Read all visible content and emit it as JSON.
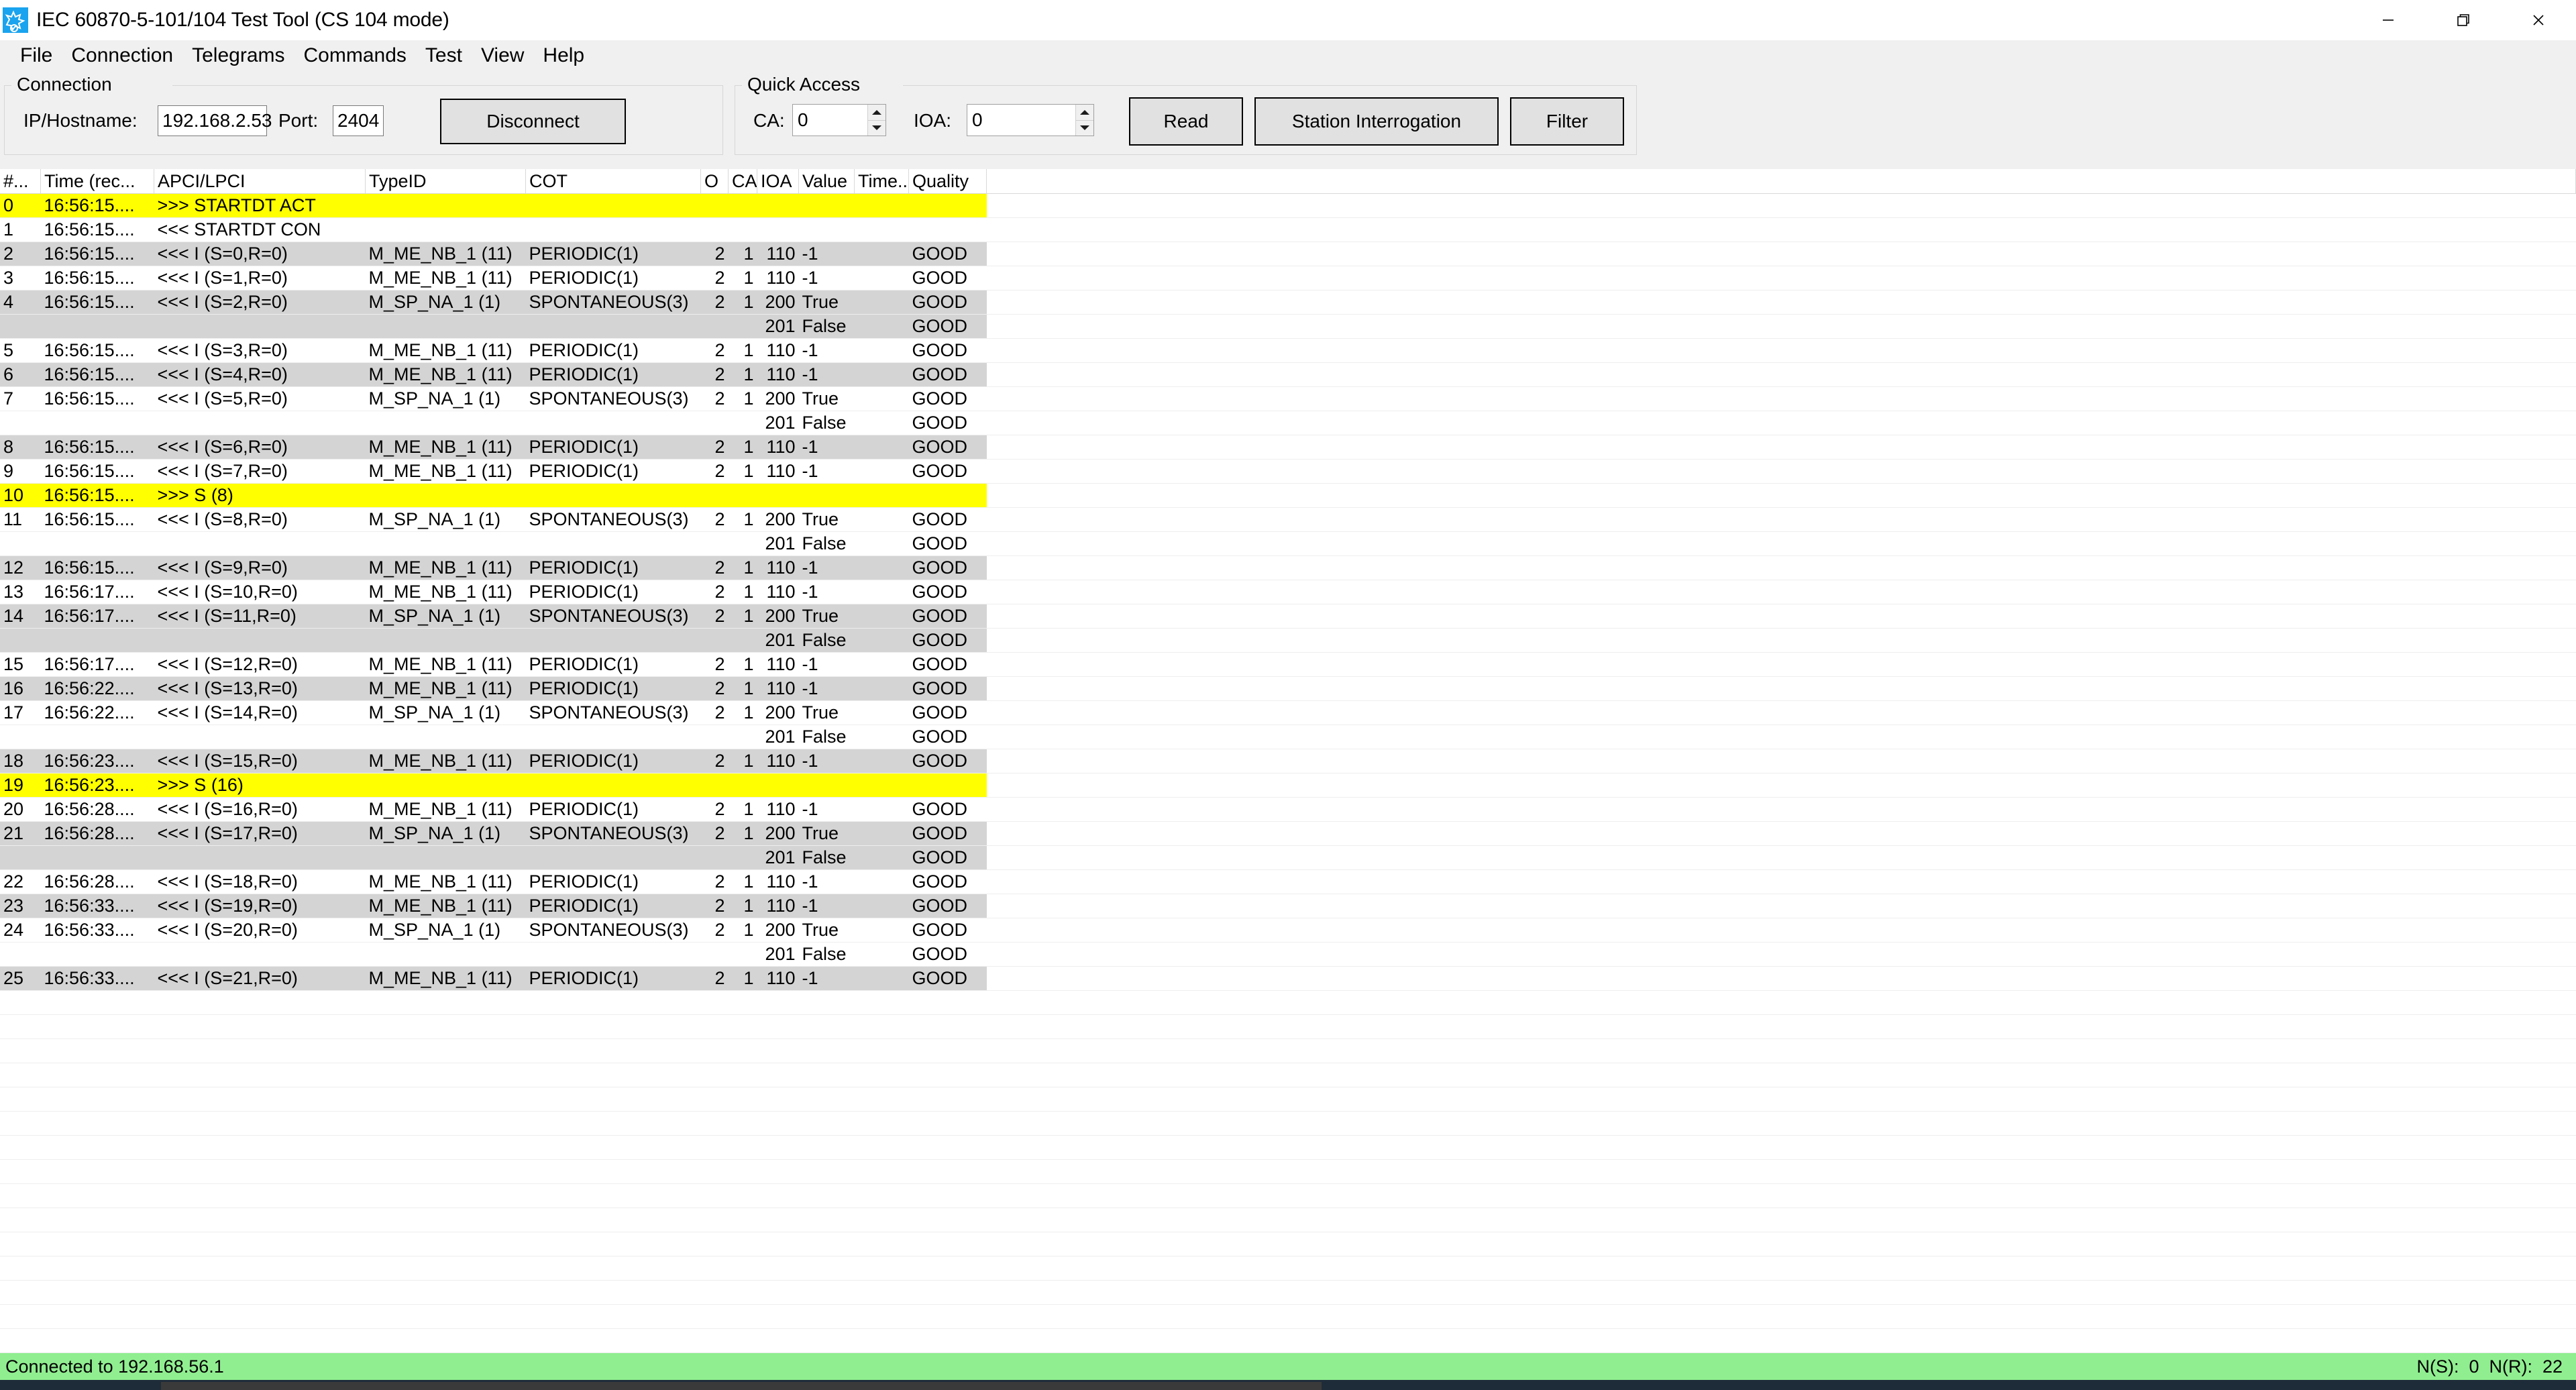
{
  "window": {
    "title": "IEC 60870-5-101/104 Test Tool (CS 104 mode)",
    "icon": "gear-app-icon",
    "minimize_label": "Minimize",
    "maximize_label": "Restore",
    "close_label": "Close"
  },
  "menu": {
    "items": [
      {
        "label": "File"
      },
      {
        "label": "Connection"
      },
      {
        "label": "Telegrams"
      },
      {
        "label": "Commands"
      },
      {
        "label": "Test"
      },
      {
        "label": "View"
      },
      {
        "label": "Help"
      }
    ]
  },
  "connection": {
    "group_title": "Connection",
    "ip_label": "IP/Hostname:",
    "ip_value": "192.168.2.53",
    "port_label": "Port:",
    "port_value": "2404",
    "disconnect_label": "Disconnect"
  },
  "quick_access": {
    "group_title": "Quick Access",
    "ca_label": "CA:",
    "ca_value": "0",
    "ioa_label": "IOA:",
    "ioa_value": "0",
    "read_label": "Read",
    "station_interrogation_label": "Station Interrogation",
    "filter_label": "Filter"
  },
  "grid": {
    "columns": [
      "#...",
      "Time (rec...",
      "APCI/LPCI",
      "TypeID",
      "COT",
      "O",
      "CA",
      "IOA",
      "Value",
      "Time...",
      "Quality"
    ],
    "rows": [
      {
        "style": "yellow",
        "num": "0",
        "time": "16:56:15....",
        "apci": ">>> STARTDT ACT",
        "type": "",
        "cot": "",
        "o": "",
        "ca": "",
        "ioa": "",
        "value": "",
        "tm": "",
        "quality": ""
      },
      {
        "style": "plain",
        "num": "1",
        "time": "16:56:15....",
        "apci": "<<< STARTDT CON",
        "type": "",
        "cot": "",
        "o": "",
        "ca": "",
        "ioa": "",
        "value": "",
        "tm": "",
        "quality": ""
      },
      {
        "style": "alt",
        "num": "2",
        "time": "16:56:15....",
        "apci": "<<< I (S=0,R=0)",
        "type": "M_ME_NB_1 (11)",
        "cot": "PERIODIC(1)",
        "o": "2",
        "ca": "1",
        "ioa": "110",
        "value": "-1",
        "tm": "",
        "quality": "GOOD"
      },
      {
        "style": "plain",
        "num": "3",
        "time": "16:56:15....",
        "apci": "<<< I (S=1,R=0)",
        "type": "M_ME_NB_1 (11)",
        "cot": "PERIODIC(1)",
        "o": "2",
        "ca": "1",
        "ioa": "110",
        "value": "-1",
        "tm": "",
        "quality": "GOOD"
      },
      {
        "style": "alt",
        "num": "4",
        "time": "16:56:15....",
        "apci": "<<< I (S=2,R=0)",
        "type": "M_SP_NA_1 (1)",
        "cot": "SPONTANEOUS(3)",
        "o": "2",
        "ca": "1",
        "ioa": "200",
        "value": "True",
        "tm": "",
        "quality": "GOOD"
      },
      {
        "style": "alt",
        "num": "",
        "time": "",
        "apci": "",
        "type": "",
        "cot": "",
        "o": "",
        "ca": "",
        "ioa": "201",
        "value": "False",
        "tm": "",
        "quality": "GOOD"
      },
      {
        "style": "plain",
        "num": "5",
        "time": "16:56:15....",
        "apci": "<<< I (S=3,R=0)",
        "type": "M_ME_NB_1 (11)",
        "cot": "PERIODIC(1)",
        "o": "2",
        "ca": "1",
        "ioa": "110",
        "value": "-1",
        "tm": "",
        "quality": "GOOD"
      },
      {
        "style": "alt",
        "num": "6",
        "time": "16:56:15....",
        "apci": "<<< I (S=4,R=0)",
        "type": "M_ME_NB_1 (11)",
        "cot": "PERIODIC(1)",
        "o": "2",
        "ca": "1",
        "ioa": "110",
        "value": "-1",
        "tm": "",
        "quality": "GOOD"
      },
      {
        "style": "plain",
        "num": "7",
        "time": "16:56:15....",
        "apci": "<<< I (S=5,R=0)",
        "type": "M_SP_NA_1 (1)",
        "cot": "SPONTANEOUS(3)",
        "o": "2",
        "ca": "1",
        "ioa": "200",
        "value": "True",
        "tm": "",
        "quality": "GOOD"
      },
      {
        "style": "plain",
        "num": "",
        "time": "",
        "apci": "",
        "type": "",
        "cot": "",
        "o": "",
        "ca": "",
        "ioa": "201",
        "value": "False",
        "tm": "",
        "quality": "GOOD"
      },
      {
        "style": "alt",
        "num": "8",
        "time": "16:56:15....",
        "apci": "<<< I (S=6,R=0)",
        "type": "M_ME_NB_1 (11)",
        "cot": "PERIODIC(1)",
        "o": "2",
        "ca": "1",
        "ioa": "110",
        "value": "-1",
        "tm": "",
        "quality": "GOOD"
      },
      {
        "style": "plain",
        "num": "9",
        "time": "16:56:15....",
        "apci": "<<< I (S=7,R=0)",
        "type": "M_ME_NB_1 (11)",
        "cot": "PERIODIC(1)",
        "o": "2",
        "ca": "1",
        "ioa": "110",
        "value": "-1",
        "tm": "",
        "quality": "GOOD"
      },
      {
        "style": "yellow",
        "num": "10",
        "time": "16:56:15....",
        "apci": ">>> S (8)",
        "type": "",
        "cot": "",
        "o": "",
        "ca": "",
        "ioa": "",
        "value": "",
        "tm": "",
        "quality": ""
      },
      {
        "style": "plain",
        "num": "11",
        "time": "16:56:15....",
        "apci": "<<< I (S=8,R=0)",
        "type": "M_SP_NA_1 (1)",
        "cot": "SPONTANEOUS(3)",
        "o": "2",
        "ca": "1",
        "ioa": "200",
        "value": "True",
        "tm": "",
        "quality": "GOOD"
      },
      {
        "style": "plain",
        "num": "",
        "time": "",
        "apci": "",
        "type": "",
        "cot": "",
        "o": "",
        "ca": "",
        "ioa": "201",
        "value": "False",
        "tm": "",
        "quality": "GOOD"
      },
      {
        "style": "alt",
        "num": "12",
        "time": "16:56:15....",
        "apci": "<<< I (S=9,R=0)",
        "type": "M_ME_NB_1 (11)",
        "cot": "PERIODIC(1)",
        "o": "2",
        "ca": "1",
        "ioa": "110",
        "value": "-1",
        "tm": "",
        "quality": "GOOD"
      },
      {
        "style": "plain",
        "num": "13",
        "time": "16:56:17....",
        "apci": "<<< I (S=10,R=0)",
        "type": "M_ME_NB_1 (11)",
        "cot": "PERIODIC(1)",
        "o": "2",
        "ca": "1",
        "ioa": "110",
        "value": "-1",
        "tm": "",
        "quality": "GOOD"
      },
      {
        "style": "alt",
        "num": "14",
        "time": "16:56:17....",
        "apci": "<<< I (S=11,R=0)",
        "type": "M_SP_NA_1 (1)",
        "cot": "SPONTANEOUS(3)",
        "o": "2",
        "ca": "1",
        "ioa": "200",
        "value": "True",
        "tm": "",
        "quality": "GOOD"
      },
      {
        "style": "alt",
        "num": "",
        "time": "",
        "apci": "",
        "type": "",
        "cot": "",
        "o": "",
        "ca": "",
        "ioa": "201",
        "value": "False",
        "tm": "",
        "quality": "GOOD"
      },
      {
        "style": "plain",
        "num": "15",
        "time": "16:56:17....",
        "apci": "<<< I (S=12,R=0)",
        "type": "M_ME_NB_1 (11)",
        "cot": "PERIODIC(1)",
        "o": "2",
        "ca": "1",
        "ioa": "110",
        "value": "-1",
        "tm": "",
        "quality": "GOOD"
      },
      {
        "style": "alt",
        "num": "16",
        "time": "16:56:22....",
        "apci": "<<< I (S=13,R=0)",
        "type": "M_ME_NB_1 (11)",
        "cot": "PERIODIC(1)",
        "o": "2",
        "ca": "1",
        "ioa": "110",
        "value": "-1",
        "tm": "",
        "quality": "GOOD"
      },
      {
        "style": "plain",
        "num": "17",
        "time": "16:56:22....",
        "apci": "<<< I (S=14,R=0)",
        "type": "M_SP_NA_1 (1)",
        "cot": "SPONTANEOUS(3)",
        "o": "2",
        "ca": "1",
        "ioa": "200",
        "value": "True",
        "tm": "",
        "quality": "GOOD"
      },
      {
        "style": "plain",
        "num": "",
        "time": "",
        "apci": "",
        "type": "",
        "cot": "",
        "o": "",
        "ca": "",
        "ioa": "201",
        "value": "False",
        "tm": "",
        "quality": "GOOD"
      },
      {
        "style": "alt",
        "num": "18",
        "time": "16:56:23....",
        "apci": "<<< I (S=15,R=0)",
        "type": "M_ME_NB_1 (11)",
        "cot": "PERIODIC(1)",
        "o": "2",
        "ca": "1",
        "ioa": "110",
        "value": "-1",
        "tm": "",
        "quality": "GOOD"
      },
      {
        "style": "yellow",
        "num": "19",
        "time": "16:56:23....",
        "apci": ">>> S (16)",
        "type": "",
        "cot": "",
        "o": "",
        "ca": "",
        "ioa": "",
        "value": "",
        "tm": "",
        "quality": ""
      },
      {
        "style": "plain",
        "num": "20",
        "time": "16:56:28....",
        "apci": "<<< I (S=16,R=0)",
        "type": "M_ME_NB_1 (11)",
        "cot": "PERIODIC(1)",
        "o": "2",
        "ca": "1",
        "ioa": "110",
        "value": "-1",
        "tm": "",
        "quality": "GOOD"
      },
      {
        "style": "alt",
        "num": "21",
        "time": "16:56:28....",
        "apci": "<<< I (S=17,R=0)",
        "type": "M_SP_NA_1 (1)",
        "cot": "SPONTANEOUS(3)",
        "o": "2",
        "ca": "1",
        "ioa": "200",
        "value": "True",
        "tm": "",
        "quality": "GOOD"
      },
      {
        "style": "alt",
        "num": "",
        "time": "",
        "apci": "",
        "type": "",
        "cot": "",
        "o": "",
        "ca": "",
        "ioa": "201",
        "value": "False",
        "tm": "",
        "quality": "GOOD"
      },
      {
        "style": "plain",
        "num": "22",
        "time": "16:56:28....",
        "apci": "<<< I (S=18,R=0)",
        "type": "M_ME_NB_1 (11)",
        "cot": "PERIODIC(1)",
        "o": "2",
        "ca": "1",
        "ioa": "110",
        "value": "-1",
        "tm": "",
        "quality": "GOOD"
      },
      {
        "style": "alt",
        "num": "23",
        "time": "16:56:33....",
        "apci": "<<< I (S=19,R=0)",
        "type": "M_ME_NB_1 (11)",
        "cot": "PERIODIC(1)",
        "o": "2",
        "ca": "1",
        "ioa": "110",
        "value": "-1",
        "tm": "",
        "quality": "GOOD"
      },
      {
        "style": "plain",
        "num": "24",
        "time": "16:56:33....",
        "apci": "<<< I (S=20,R=0)",
        "type": "M_SP_NA_1 (1)",
        "cot": "SPONTANEOUS(3)",
        "o": "2",
        "ca": "1",
        "ioa": "200",
        "value": "True",
        "tm": "",
        "quality": "GOOD"
      },
      {
        "style": "plain",
        "num": "",
        "time": "",
        "apci": "",
        "type": "",
        "cot": "",
        "o": "",
        "ca": "",
        "ioa": "201",
        "value": "False",
        "tm": "",
        "quality": "GOOD"
      },
      {
        "style": "alt",
        "num": "25",
        "time": "16:56:33....",
        "apci": "<<< I (S=21,R=0)",
        "type": "M_ME_NB_1 (11)",
        "cot": "PERIODIC(1)",
        "o": "2",
        "ca": "1",
        "ioa": "110",
        "value": "-1",
        "tm": "",
        "quality": "GOOD"
      }
    ]
  },
  "statusbar": {
    "left_text": "Connected to 192.168.56.1",
    "right_text": "N(S):  0  N(R):  22",
    "background": "#90ee90"
  },
  "colors": {
    "highlight_yellow": "#ffff00",
    "alt_row_gray": "#d4d4d4",
    "toolbar_gray": "#f0f0f0",
    "status_green": "#90ee90",
    "icon_blue": "#1aa3ee"
  }
}
